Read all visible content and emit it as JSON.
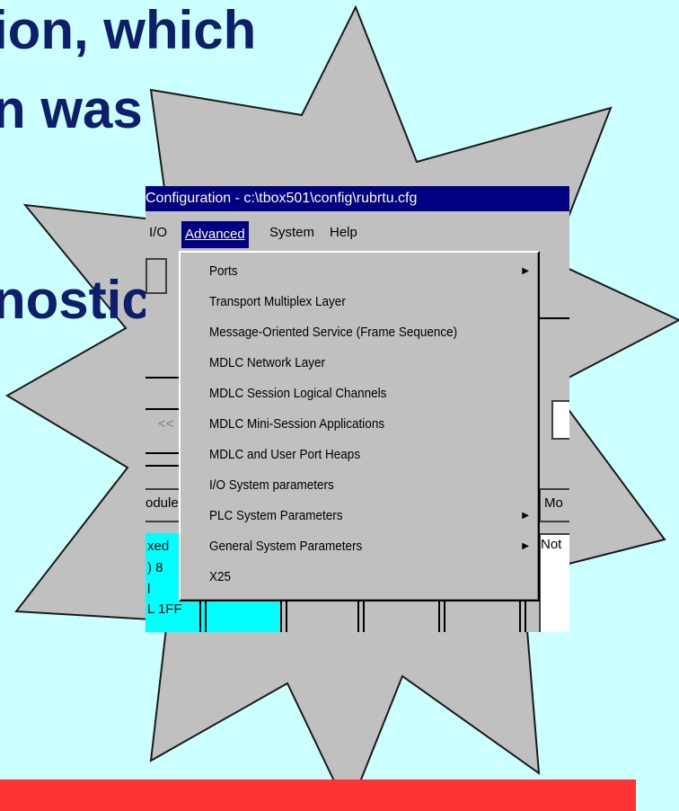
{
  "slide": {
    "line1": "ion, which",
    "line2": "n was",
    "line3": "nostics"
  },
  "window": {
    "title": "Configuration - c:\\tbox501\\config\\rubrtu.cfg",
    "menu": {
      "io": "I/O",
      "advanced": "Advanced",
      "system": "System",
      "help": "Help"
    },
    "dropdown": [
      {
        "label": "Ports",
        "submenu": true
      },
      {
        "label": "Transport Multiplex Layer",
        "submenu": false
      },
      {
        "label": "Message-Oriented Service (Frame Sequence)",
        "submenu": false
      },
      {
        "label": "MDLC Network Layer",
        "submenu": false
      },
      {
        "label": "MDLC Session Logical Channels",
        "submenu": false
      },
      {
        "label": "MDLC Mini-Session Applications",
        "submenu": false
      },
      {
        "label": "MDLC and User Port Heaps",
        "submenu": false
      },
      {
        "label": "I/O System parameters",
        "submenu": false
      },
      {
        "label": "PLC System Parameters",
        "submenu": true
      },
      {
        "label": "General System Parameters",
        "submenu": true
      },
      {
        "label": "X25",
        "submenu": false
      }
    ],
    "fragments": {
      "back": "<<",
      "module": "odule",
      "mod_right": "Mo",
      "not_right": "Not",
      "row1": "xed",
      "row2": ") 8",
      "row3": "l",
      "row4": "L 1FF"
    }
  },
  "colors": {
    "background": "#ccffff",
    "text": "#0d1f6b",
    "starburst": "#c0c0c0",
    "title_bar": "#000080",
    "accent_bar": "#ff3333"
  }
}
